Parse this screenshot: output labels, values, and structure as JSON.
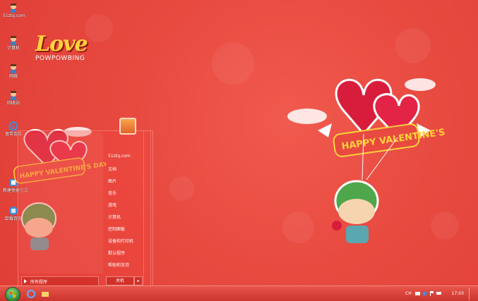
{
  "desktop": {
    "icons": [
      {
        "label": "51ztq.com",
        "icon": "user-icon"
      },
      {
        "label": "计算机",
        "icon": "computer-icon"
      },
      {
        "label": "网络",
        "icon": "network-icon"
      },
      {
        "label": "回收站",
        "icon": "recycle-bin-icon"
      },
      {
        "label": "宽带连接",
        "icon": "ie-icon"
      },
      {
        "label": "新建快捷方式",
        "icon": "shortcut-icon"
      },
      {
        "label": "卸载百度",
        "icon": "uninstall-icon"
      }
    ]
  },
  "logo": {
    "word": "Love",
    "brand": "POWPOWBING"
  },
  "wallpaper": {
    "banner_text": "HAPPY VALENTINE'S DAY"
  },
  "start_menu": {
    "right_items": [
      "51ztq.com",
      "文档",
      "图片",
      "音乐",
      "游戏",
      "计算机",
      "控制面板",
      "设备和打印机",
      "默认程序",
      "帮助和支持"
    ],
    "all_programs_label": "所有程序",
    "shutdown_label": "关机"
  },
  "taskbar": {
    "clock": "17:03",
    "lang": "CH"
  },
  "colors": {
    "background": "#e84a40",
    "accent": "#ffd33a",
    "taskbar": "#c9332c"
  }
}
